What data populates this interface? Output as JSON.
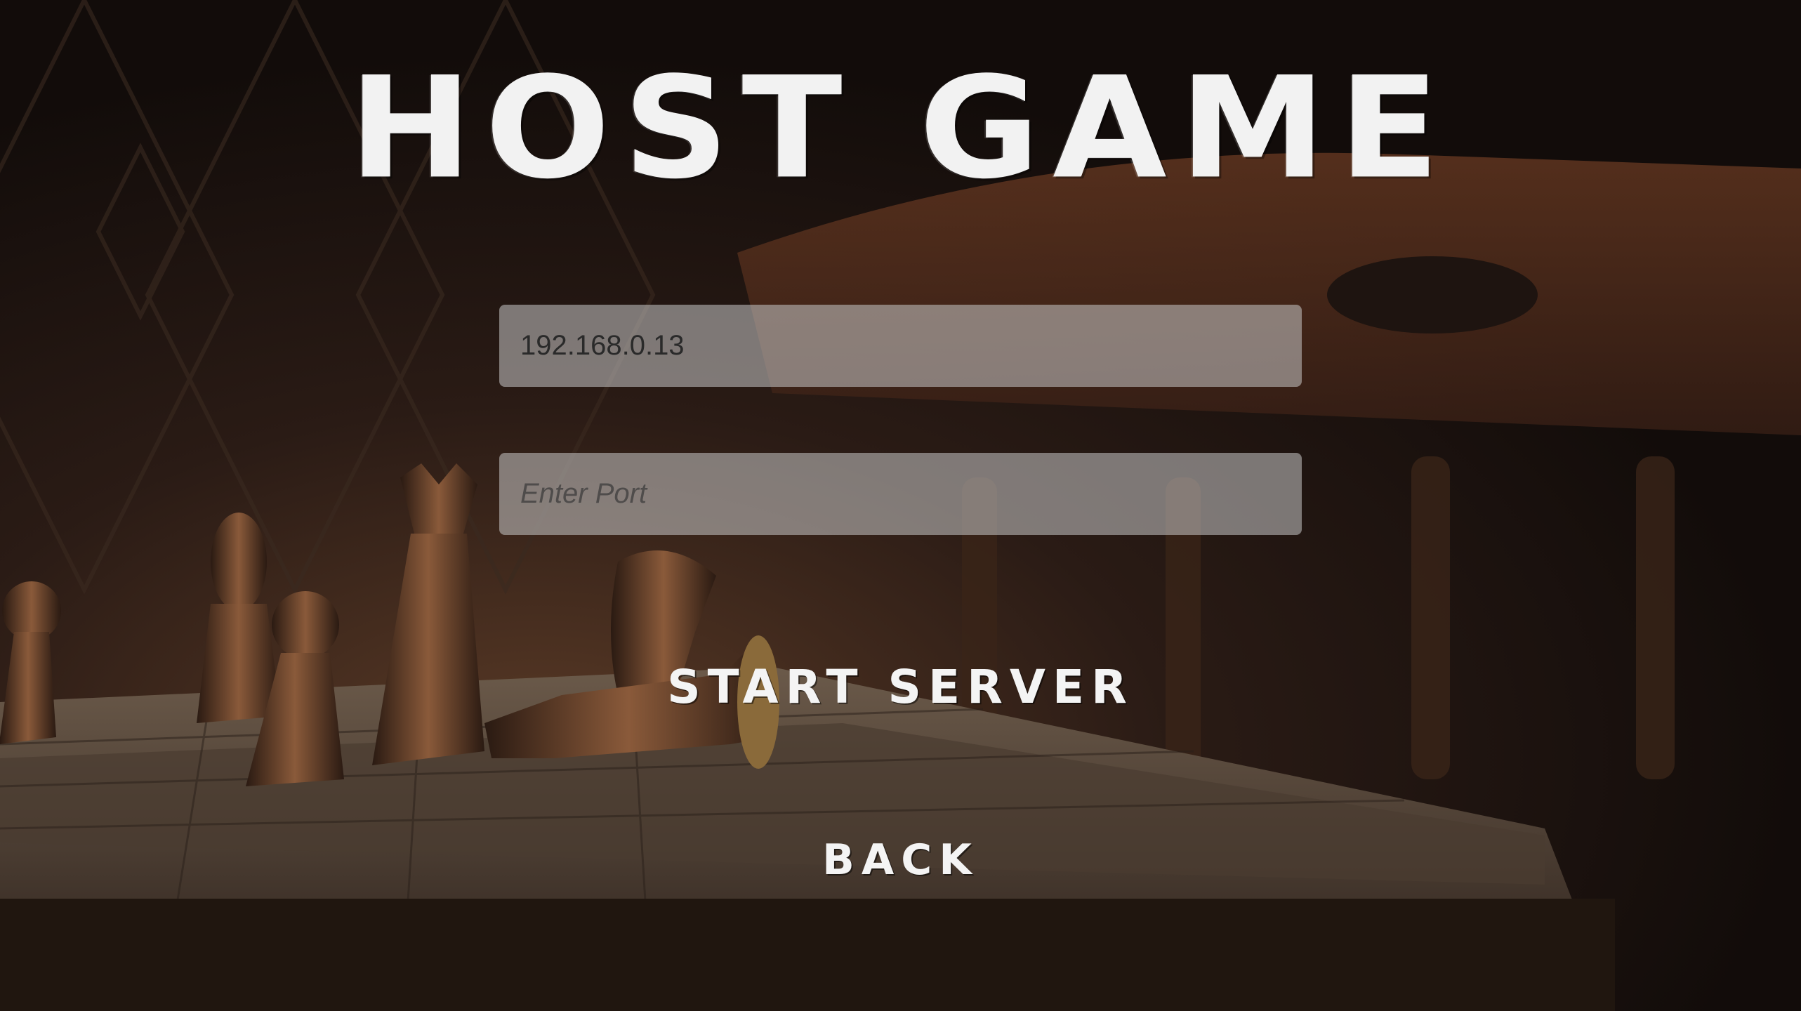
{
  "screen": {
    "title": "HOST GAME"
  },
  "ip_field": {
    "value": "192.168.0.13"
  },
  "port_field": {
    "value": "",
    "placeholder": "Enter Port"
  },
  "buttons": {
    "start_server": "START SERVER",
    "back": "BACK"
  },
  "colors": {
    "title": "#f2f2f2",
    "field_bg": "#c8c8c8",
    "button_text": "#f4f4f4"
  }
}
